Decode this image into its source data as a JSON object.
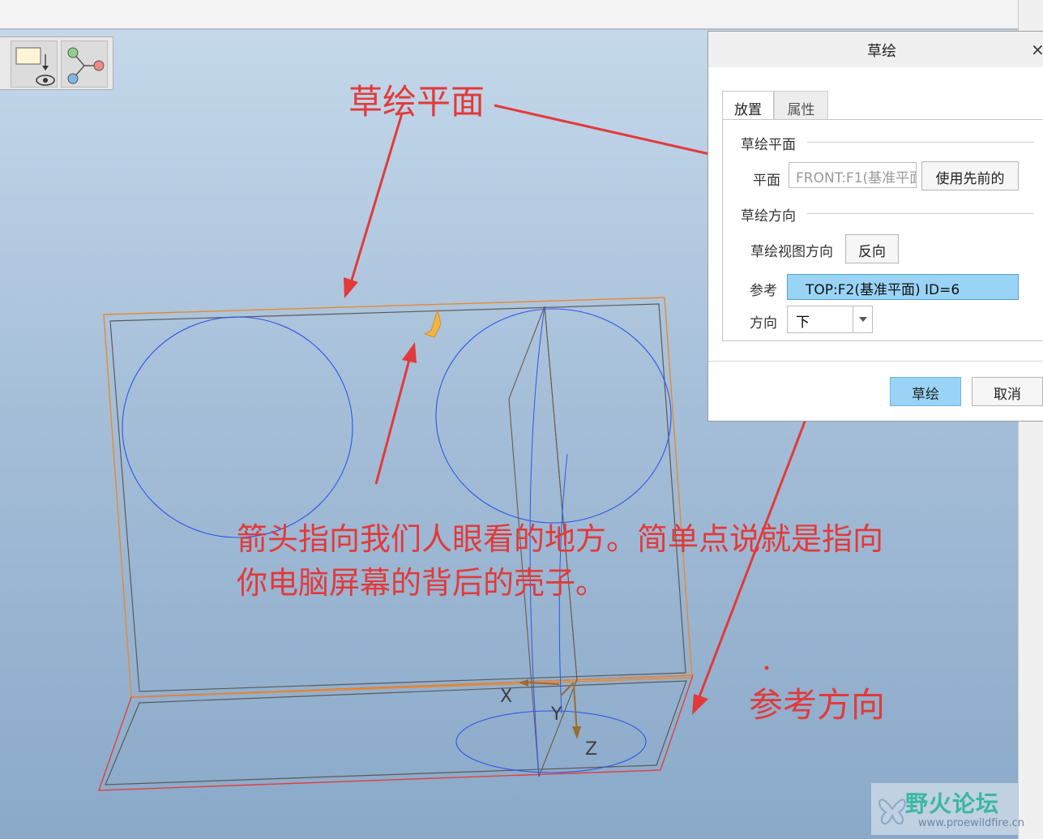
{
  "dialog": {
    "title": "草绘",
    "close": "×",
    "tabs": [
      {
        "label": "放置",
        "active": true
      },
      {
        "label": "属性",
        "active": false
      }
    ],
    "sketch_plane": {
      "section_label": "草绘平面",
      "plane_label": "平面",
      "plane_value": "FRONT:F1(基准平面)",
      "use_previous_label": "使用先前的"
    },
    "sketch_orientation": {
      "section_label": "草绘方向",
      "view_direction_label": "草绘视图方向",
      "flip_label": "反向",
      "reference_label": "参考",
      "reference_value": "TOP:F2(基准平面) ID=6",
      "orientation_label": "方向",
      "orientation_value": "下"
    },
    "ok_label": "草绘",
    "cancel_label": "取消"
  },
  "annotations": {
    "plane_note": "草绘平面",
    "direction_note_line1": "箭头指向我们人眼看的地方。简单点说就是指向",
    "direction_note_line2": "你电脑屏幕的背后的壳子。",
    "reference_note": "参考方向"
  },
  "axes": {
    "x": "X",
    "y": "Y",
    "z": "Z"
  },
  "watermark": {
    "name": "野火论坛",
    "url": "www.proewildfire.cn"
  },
  "colors": {
    "annotation": "#e23a3a",
    "highlight": "#99d4f7",
    "sketch_circle": "#2f55e6",
    "plane_outline": "#e58a2f",
    "part_edge": "#4a4a4a",
    "datum_red": "#e04040"
  },
  "toolbar": {
    "icons": [
      "sketch-view-icon",
      "references-icon"
    ]
  }
}
